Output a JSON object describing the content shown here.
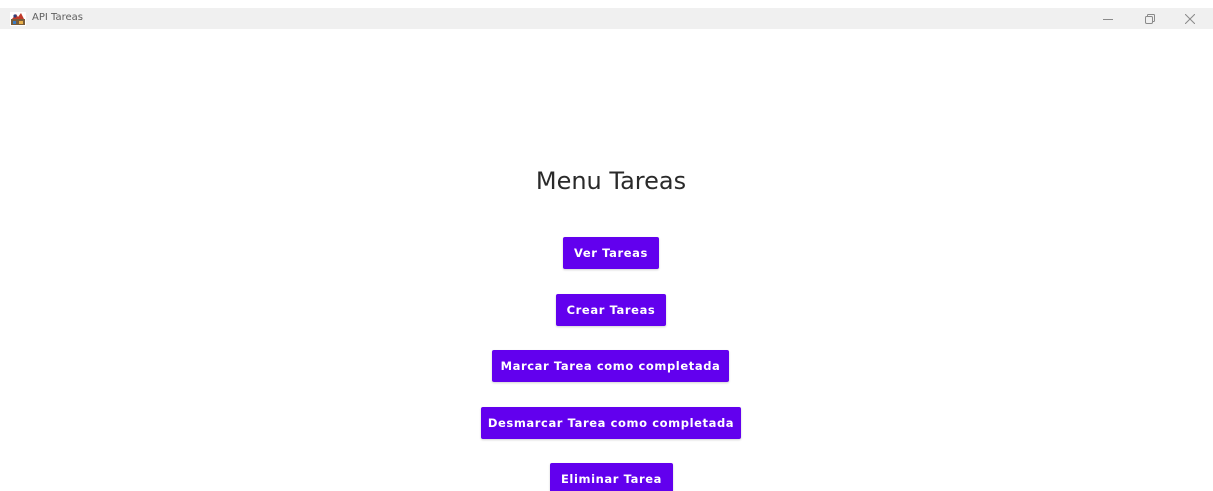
{
  "window": {
    "title": "API Tareas",
    "app_icon": "java-app-icon",
    "controls": {
      "minimize_icon": "minimize-icon",
      "restore_icon": "restore-icon",
      "close_icon": "close-icon"
    }
  },
  "main": {
    "title": "Menu Tareas",
    "buttons": {
      "ver_tareas": "Ver Tareas",
      "crear_tareas": "Crear Tareas",
      "marcar_completada": "Marcar Tarea como completada",
      "desmarcar_completada": "Desmarcar Tarea como completada",
      "eliminar_tarea": "Eliminar Tarea"
    }
  },
  "colors": {
    "accent": "#6200ee",
    "titlebar": "#f0f0f0",
    "background": "#ffffff"
  }
}
